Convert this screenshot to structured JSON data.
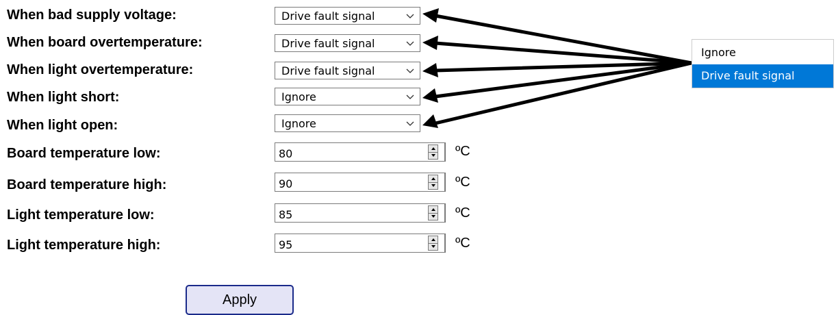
{
  "form": {
    "rows": [
      {
        "label": "When bad supply voltage:",
        "value": "Drive fault signal"
      },
      {
        "label": "When board overtemperature:",
        "value": "Drive fault signal"
      },
      {
        "label": "When light overtemperature:",
        "value": "Drive fault signal"
      },
      {
        "label": "When light short:",
        "value": "Ignore"
      },
      {
        "label": "When light open:",
        "value": "Ignore"
      }
    ],
    "numbers": [
      {
        "label": "Board temperature low:",
        "value": "80",
        "unit": "ºC"
      },
      {
        "label": "Board temperature high:",
        "value": "90",
        "unit": "ºC"
      },
      {
        "label": "Light temperature low:",
        "value": "85",
        "unit": "ºC"
      },
      {
        "label": "Light temperature high:",
        "value": "95",
        "unit": "ºC"
      }
    ],
    "apply_label": "Apply"
  },
  "dropdown": {
    "options": [
      "Ignore",
      "Drive fault signal"
    ],
    "selected": "Drive fault signal"
  },
  "colors": {
    "highlight": "#0078d7",
    "apply_bg": "#e4e4f6",
    "apply_border": "#1a2a8a"
  }
}
